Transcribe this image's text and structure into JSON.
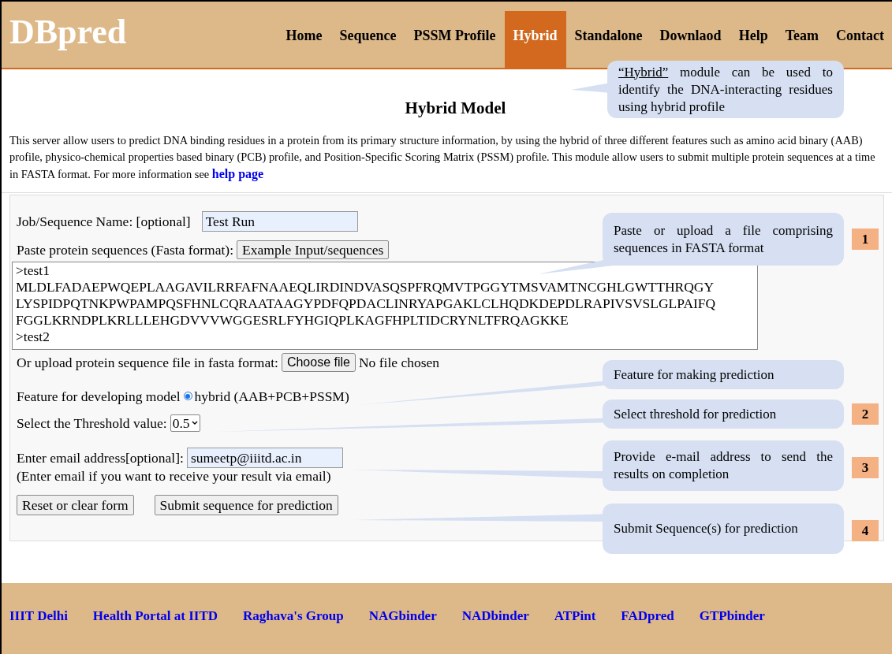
{
  "header": {
    "logo": "DBpred",
    "nav": [
      {
        "label": "Home",
        "selected": false
      },
      {
        "label": "Sequence",
        "selected": false
      },
      {
        "label": "PSSM Profile",
        "selected": false
      },
      {
        "label": "Hybrid",
        "selected": true
      },
      {
        "label": "Standalone",
        "selected": false
      },
      {
        "label": "Downlaod",
        "selected": false
      },
      {
        "label": "Help",
        "selected": false
      },
      {
        "label": "Team",
        "selected": false
      },
      {
        "label": "Contact",
        "selected": false
      }
    ]
  },
  "title": "Hybrid Model",
  "intro": {
    "text": "This server allow users to predict DNA binding residues in a protein from its primary structure information, by using the hybrid of three different features such as amino acid binary (AAB) profile, physico-chemical properties based binary (PCB) profile, and Position-Specific Scoring Matrix (PSSM) profile. This module allow users to submit multiple protein sequences at a time in FASTA format. For more information see",
    "link": "help page"
  },
  "form": {
    "job_label": "Job/Sequence Name: [optional]",
    "job_value": "Test Run",
    "paste_label": "Paste protein sequences (Fasta format):",
    "example_button": "Example Input/sequences",
    "sequences": [
      ">test1",
      "MLDLFADAEPWQEPLAAGAVILRRFAFNAAEQLIRDINDVASQSPFRQMVTPGGYTMSVAMTNCGHLGWTTHRQGY",
      "LYSPIDPQTNKPWPAMPQSFHNLCQRAATAAGYPDFQPDACLINRYAPGAKLCLHQDKDEPDLRAPIVSVSLGLPAIFQ",
      "FGGLKRNDPLKRLLLEHGDVVVWGGESRLFYHGIQPLKAGFHPLTIDCRYNLTFRQAGKKE",
      ">test2"
    ],
    "upload_label": "Or upload protein sequence file in fasta format:",
    "choose_button": "Choose file",
    "file_status": "No file chosen",
    "feature_label": "Feature for developing model",
    "feature_option": {
      "label": "hybrid (AAB+PCB+PSSM)",
      "selected": true
    },
    "threshold_label": "Select the Threshold value:",
    "threshold_value": "0.5",
    "email_label": "Enter email address[optional]:",
    "email_value": "sumeetp@iiitd.ac.in",
    "email_note": "(Enter email if you want to receive your result via email)",
    "reset_button": "Reset or clear form",
    "submit_button": "Submit sequence for prediction"
  },
  "annotations": [
    {
      "term": "“Hybrid”",
      "text": "module can be used to identify the DNA-interacting residues using hybrid profile"
    },
    {
      "text": "Paste or upload a file comprising sequences in FASTA format",
      "badge": "1"
    },
    {
      "text": "Feature for making prediction"
    },
    {
      "text": "Select threshold for prediction",
      "badge": "2"
    },
    {
      "text": "Provide e-mail address to send the results on completion",
      "badge": "3"
    },
    {
      "text": "Submit Sequence(s) for prediction",
      "badge": "4"
    }
  ],
  "footer": {
    "links": [
      "IIIT Delhi",
      "Health Portal at IITD",
      "Raghava's Group",
      "NAGbinder",
      "NADbinder",
      "ATPint",
      "FADpred",
      "GTPbinder"
    ]
  }
}
